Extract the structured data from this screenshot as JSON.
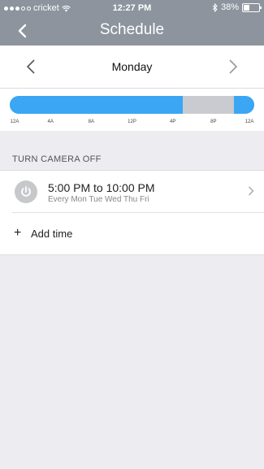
{
  "status": {
    "carrier": "cricket",
    "time": "12:27 PM",
    "battery": "38%",
    "battery_level": 0.38
  },
  "nav": {
    "title": "Schedule",
    "back_icon": "chevron-left-icon"
  },
  "day_selector": {
    "day": "Monday",
    "prev_icon": "chevron-left-icon",
    "next_icon": "chevron-right-icon"
  },
  "timeline": {
    "tick_labels": [
      "12A",
      "4A",
      "8A",
      "12P",
      "4P",
      "8P",
      "12A"
    ],
    "camera_on_color": "#3aa6f4",
    "camera_off_color": "#c9cbd0",
    "on_ranges_hours": [
      [
        0,
        17
      ],
      [
        22,
        24
      ]
    ]
  },
  "section": {
    "label": "TURN CAMERA OFF"
  },
  "schedule_item": {
    "time_range": "5:00 PM to 10:00 PM",
    "days": "Every Mon Tue Wed Thu Fri",
    "icon": "power-icon"
  },
  "add_time": {
    "label": "Add time",
    "icon": "plus-icon"
  }
}
